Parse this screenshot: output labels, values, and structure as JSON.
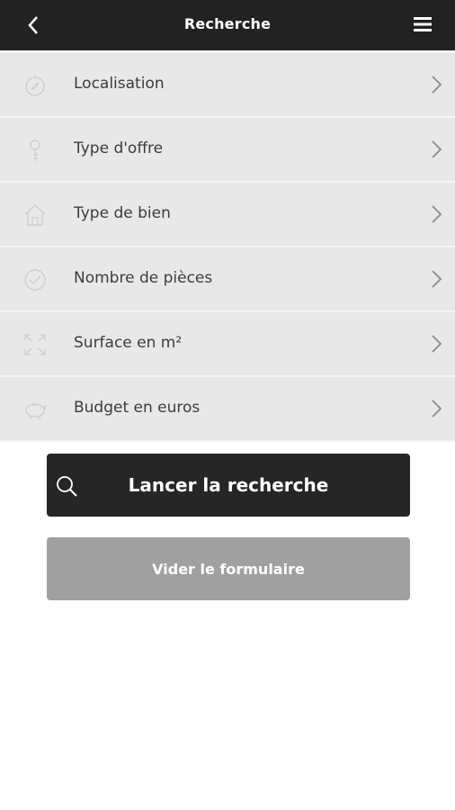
{
  "header": {
    "title": "Recherche",
    "back_icon": "chevron-left-icon",
    "menu_icon": "hamburger-menu-icon"
  },
  "criteria": [
    {
      "label": "Localisation",
      "icon": "compass-icon"
    },
    {
      "label": "Type d'offre",
      "icon": "key-icon"
    },
    {
      "label": "Type de bien",
      "icon": "house-icon"
    },
    {
      "label": "Nombre de pièces",
      "icon": "check-circle-icon"
    },
    {
      "label": "Surface en m²",
      "icon": "expand-arrows-icon"
    },
    {
      "label": "Budget en euros",
      "icon": "piggy-bank-icon"
    }
  ],
  "actions": {
    "search_label": "Lancer la recherche",
    "clear_label": "Vider le formulaire"
  },
  "colors": {
    "topbar": "#222222",
    "row_background": "#e8e8e8",
    "search_button": "#262626",
    "clear_button": "#a0a0a0"
  }
}
